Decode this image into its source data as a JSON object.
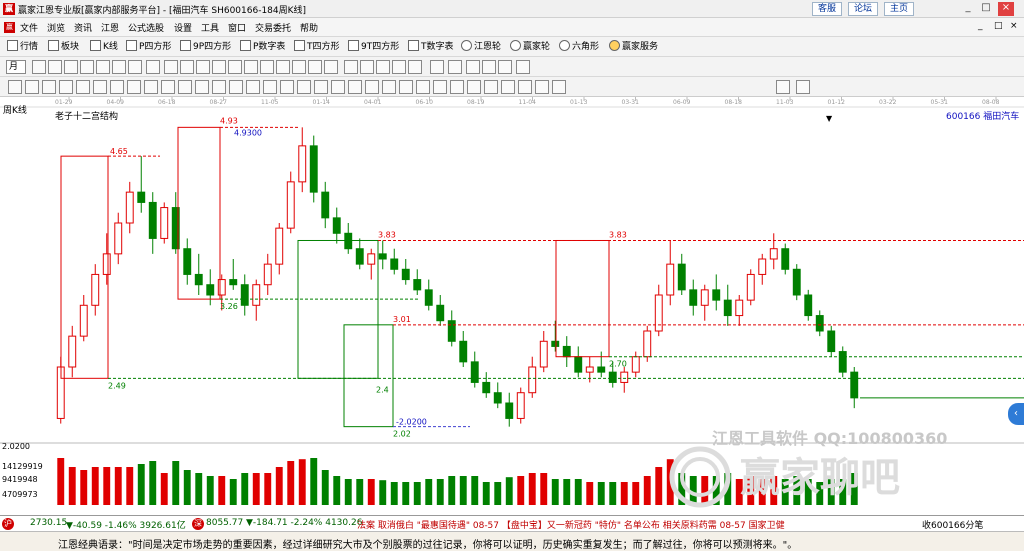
{
  "window": {
    "logo": "赢",
    "title": "赢家江恩专业版[赢家内部服务平台] - [福田汽车   SH600166-184周K线]",
    "links": [
      "客服",
      "论坛",
      "主页"
    ],
    "controls": [
      "_",
      "□",
      "×"
    ]
  },
  "menu": {
    "logo": "赢",
    "items": [
      "文件",
      "浏览",
      "资讯",
      "江恩",
      "公式选股",
      "设置",
      "工具",
      "窗口",
      "交易委托",
      "帮助"
    ],
    "right_controls": [
      "_",
      "□",
      "×"
    ]
  },
  "toolbar1": [
    "行情",
    "板块",
    "K线",
    "P四方形",
    "9P四方形",
    "P数字表",
    "T四方形",
    "9T四方形",
    "T数字表",
    "江恩轮",
    "赢家轮",
    "六角形",
    "赢家服务"
  ],
  "toolbar2": {
    "period_select": "月"
  },
  "chart": {
    "period": "周K线",
    "indicator": "老子十二宫结构",
    "symbol": "600166  福田汽车",
    "dropdown": "▼",
    "date_ticks": [
      "01-29",
      "04-09",
      "06-18",
      "08-27",
      "11-05",
      "01-14",
      "04-01",
      "06-10",
      "08-19",
      "11-04",
      "01-13",
      "03-31",
      "06-09",
      "08-18",
      "11-03",
      "01-12",
      "03-22",
      "05-31",
      "08-08"
    ],
    "price_labels": {
      "high1": "4.65",
      "high2": "4.93",
      "high2_blue": "4.9300",
      "low1": "2.49",
      "low2": "3.26",
      "mid1": "3.83",
      "mid2": "3.01",
      "low3": "2.02",
      "low3_blue": "-2.0200",
      "box_mid": "2.70",
      "right_high": "3.83",
      "small1": "2.4"
    },
    "volume_labels": [
      "2.0200",
      "14129919",
      "9419948",
      "4709973"
    ],
    "watermark_top": "江恩工具软件   QQ:100800360",
    "watermark_bottom": "赢家聊吧",
    "colors": {
      "up": "#e00000",
      "down": "#008000",
      "blue": "#1010c0",
      "ref": "#4040d0"
    },
    "chart_data": {
      "type": "candlestick",
      "title": "老子十二宫结构",
      "series_note": "weekly K-line, approximate",
      "ohlc": [
        [
          2.1,
          2.7,
          2.05,
          2.6
        ],
        [
          2.6,
          3.0,
          2.5,
          2.9
        ],
        [
          2.9,
          3.3,
          2.85,
          3.2
        ],
        [
          3.2,
          3.6,
          3.1,
          3.5
        ],
        [
          3.5,
          3.9,
          3.4,
          3.7
        ],
        [
          3.7,
          4.1,
          3.6,
          4.0
        ],
        [
          4.0,
          4.4,
          3.9,
          4.3
        ],
        [
          4.3,
          4.65,
          4.1,
          4.2
        ],
        [
          4.2,
          4.3,
          3.7,
          3.85
        ],
        [
          3.85,
          4.2,
          3.8,
          4.15
        ],
        [
          4.15,
          4.3,
          3.7,
          3.75
        ],
        [
          3.75,
          3.85,
          3.4,
          3.5
        ],
        [
          3.5,
          3.7,
          3.3,
          3.4
        ],
        [
          3.4,
          3.55,
          3.2,
          3.3
        ],
        [
          3.3,
          3.5,
          3.15,
          3.45
        ],
        [
          3.45,
          3.65,
          3.35,
          3.4
        ],
        [
          3.4,
          3.5,
          3.1,
          3.2
        ],
        [
          3.2,
          3.45,
          3.05,
          3.4
        ],
        [
          3.4,
          3.7,
          3.3,
          3.6
        ],
        [
          3.6,
          4.0,
          3.5,
          3.95
        ],
        [
          3.95,
          4.5,
          3.9,
          4.4
        ],
        [
          4.4,
          4.93,
          4.3,
          4.75
        ],
        [
          4.75,
          4.85,
          4.2,
          4.3
        ],
        [
          4.3,
          4.4,
          3.95,
          4.05
        ],
        [
          4.05,
          4.15,
          3.8,
          3.9
        ],
        [
          3.9,
          4.0,
          3.7,
          3.75
        ],
        [
          3.75,
          3.85,
          3.55,
          3.6
        ],
        [
          3.6,
          3.75,
          3.45,
          3.7
        ],
        [
          3.7,
          3.83,
          3.55,
          3.65
        ],
        [
          3.65,
          3.75,
          3.5,
          3.55
        ],
        [
          3.55,
          3.65,
          3.4,
          3.45
        ],
        [
          3.45,
          3.55,
          3.3,
          3.35
        ],
        [
          3.35,
          3.45,
          3.15,
          3.2
        ],
        [
          3.2,
          3.3,
          3.0,
          3.05
        ],
        [
          3.05,
          3.15,
          2.8,
          2.85
        ],
        [
          2.85,
          2.95,
          2.6,
          2.65
        ],
        [
          2.65,
          2.75,
          2.4,
          2.45
        ],
        [
          2.45,
          2.55,
          2.3,
          2.35
        ],
        [
          2.35,
          2.45,
          2.2,
          2.25
        ],
        [
          2.25,
          2.35,
          2.02,
          2.1
        ],
        [
          2.1,
          2.4,
          2.05,
          2.35
        ],
        [
          2.35,
          2.7,
          2.3,
          2.6
        ],
        [
          2.6,
          2.95,
          2.55,
          2.85
        ],
        [
          2.85,
          3.05,
          2.75,
          2.8
        ],
        [
          2.8,
          2.9,
          2.6,
          2.7
        ],
        [
          2.7,
          2.8,
          2.5,
          2.55
        ],
        [
          2.55,
          2.7,
          2.45,
          2.6
        ],
        [
          2.6,
          2.75,
          2.5,
          2.55
        ],
        [
          2.55,
          2.65,
          2.4,
          2.45
        ],
        [
          2.45,
          2.6,
          2.35,
          2.55
        ],
        [
          2.55,
          2.75,
          2.5,
          2.7
        ],
        [
          2.7,
          3.0,
          2.65,
          2.95
        ],
        [
          2.95,
          3.4,
          2.9,
          3.3
        ],
        [
          3.3,
          3.83,
          3.2,
          3.6
        ],
        [
          3.6,
          3.7,
          3.3,
          3.35
        ],
        [
          3.35,
          3.45,
          3.1,
          3.2
        ],
        [
          3.2,
          3.4,
          3.05,
          3.35
        ],
        [
          3.35,
          3.5,
          3.15,
          3.25
        ],
        [
          3.25,
          3.4,
          3.0,
          3.1
        ],
        [
          3.1,
          3.3,
          3.0,
          3.25
        ],
        [
          3.25,
          3.55,
          3.2,
          3.5
        ],
        [
          3.5,
          3.7,
          3.4,
          3.65
        ],
        [
          3.65,
          3.9,
          3.55,
          3.75
        ],
        [
          3.75,
          3.8,
          3.5,
          3.55
        ],
        [
          3.55,
          3.6,
          3.25,
          3.3
        ],
        [
          3.3,
          3.35,
          3.05,
          3.1
        ],
        [
          3.1,
          3.15,
          2.9,
          2.95
        ],
        [
          2.95,
          3.0,
          2.7,
          2.75
        ],
        [
          2.75,
          2.8,
          2.5,
          2.55
        ],
        [
          2.55,
          2.6,
          2.2,
          2.3
        ]
      ]
    }
  },
  "status": {
    "idx1_icon": "沪",
    "idx1": "2730.15",
    "idx1_chg": "▼-40.59 -1.46% 3926.61亿",
    "idx2_icon": "深",
    "idx2": "8055.77",
    "idx2_chg": "▼-184.71 -2.24% 4130.26",
    "news": "法案 取消俄白 \"最惠国待遇\"  08-57 【盘中宝】又一新冠药 \"特仿\" 名单公布  相关原料药需  08-57  国家卫健",
    "right": "收600166分笔"
  },
  "quote": {
    "text": "江恩经典语录：\"时间是决定市场走势的重要因素，经过详细研究大市及个别股票的过往记录，你将可以证明，历史确实重复发生；而了解过往，你将可以预测将来。\"。"
  }
}
